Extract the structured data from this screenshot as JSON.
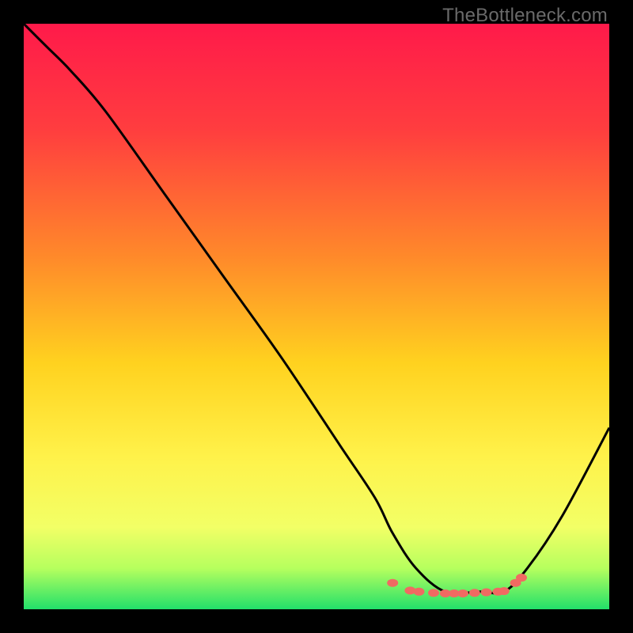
{
  "watermark": "TheBottleneck.com",
  "chart_data": {
    "type": "line",
    "title": "",
    "xlabel": "",
    "ylabel": "",
    "xlim": [
      0,
      100
    ],
    "ylim": [
      0,
      100
    ],
    "gradient_stops": [
      {
        "offset": 0,
        "color": "#ff1a4a"
      },
      {
        "offset": 18,
        "color": "#ff3d3f"
      },
      {
        "offset": 40,
        "color": "#ff8a2a"
      },
      {
        "offset": 58,
        "color": "#ffd21f"
      },
      {
        "offset": 74,
        "color": "#fff24a"
      },
      {
        "offset": 86,
        "color": "#f2ff66"
      },
      {
        "offset": 93,
        "color": "#b6ff5e"
      },
      {
        "offset": 100,
        "color": "#22e06a"
      }
    ],
    "series": [
      {
        "name": "bottleneck-curve",
        "color": "#000000",
        "x": [
          0,
          4,
          8,
          14,
          24,
          34,
          44,
          54,
          60,
          63,
          67,
          72,
          78,
          82,
          86,
          92,
          100
        ],
        "values": [
          100,
          96,
          92,
          85,
          71,
          57,
          43,
          28,
          19,
          13,
          7,
          3,
          3,
          3,
          7,
          16,
          31
        ]
      }
    ],
    "markers": {
      "name": "optimal-range",
      "color": "#f06a62",
      "points": [
        {
          "x": 63,
          "y": 4.5
        },
        {
          "x": 66,
          "y": 3.2
        },
        {
          "x": 67.5,
          "y": 3.0
        },
        {
          "x": 70,
          "y": 2.8
        },
        {
          "x": 72,
          "y": 2.7
        },
        {
          "x": 73.5,
          "y": 2.7
        },
        {
          "x": 75,
          "y": 2.7
        },
        {
          "x": 77,
          "y": 2.8
        },
        {
          "x": 79,
          "y": 2.9
        },
        {
          "x": 81,
          "y": 3.0
        },
        {
          "x": 82,
          "y": 3.1
        },
        {
          "x": 84,
          "y": 4.5
        },
        {
          "x": 85,
          "y": 5.4
        }
      ]
    }
  }
}
